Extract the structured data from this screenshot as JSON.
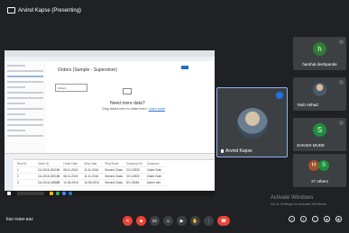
{
  "header": {
    "presenting_label": "Arvind Kapse (Presenting)"
  },
  "shared_screen": {
    "worksheet_title": "Orders (Sample - Superstore)",
    "placeholder_box": "Orders",
    "empty_title": "Need more data?",
    "empty_sub": "Drag tables here to relate them.",
    "learn_more": "Learn more",
    "table_columns": [
      "Row ID",
      "Order ID",
      "Order Date",
      "Ship Date",
      "Ship Mode",
      "Customer ID",
      "Customer"
    ],
    "table_rows": [
      [
        "1",
        "CA-2016-152156",
        "08-11-2016",
        "11-11-2016",
        "Second Class",
        "CG-12520",
        "Claire Gute"
      ],
      [
        "2",
        "CA-2016-152156",
        "08-11-2016",
        "11-11-2016",
        "Second Class",
        "CG-12520",
        "Claire Gute"
      ],
      [
        "3",
        "CA-2016-138688",
        "12-06-2016",
        "16-06-2016",
        "Second Class",
        "DV-13045",
        "Darrin Van"
      ]
    ]
  },
  "presenter": {
    "name": "Arvind Kapse"
  },
  "participants": [
    {
      "initial": "h",
      "name": "harshal deshpande",
      "color": "#2e7d32"
    },
    {
      "initial": "",
      "name": "Yash Akhad",
      "color": "#5f6368"
    },
    {
      "initial": "S",
      "name": "SAKSHI MUDE",
      "color": "#1e8e3e"
    }
  ],
  "others": {
    "label": "27 others",
    "initials": [
      "H",
      "S"
    ]
  },
  "footer": {
    "meeting_code": "kaz-rsaw-aaz"
  },
  "watermark": {
    "title": "Activate Windows",
    "subtitle": "Go to Settings to activate Windows."
  }
}
